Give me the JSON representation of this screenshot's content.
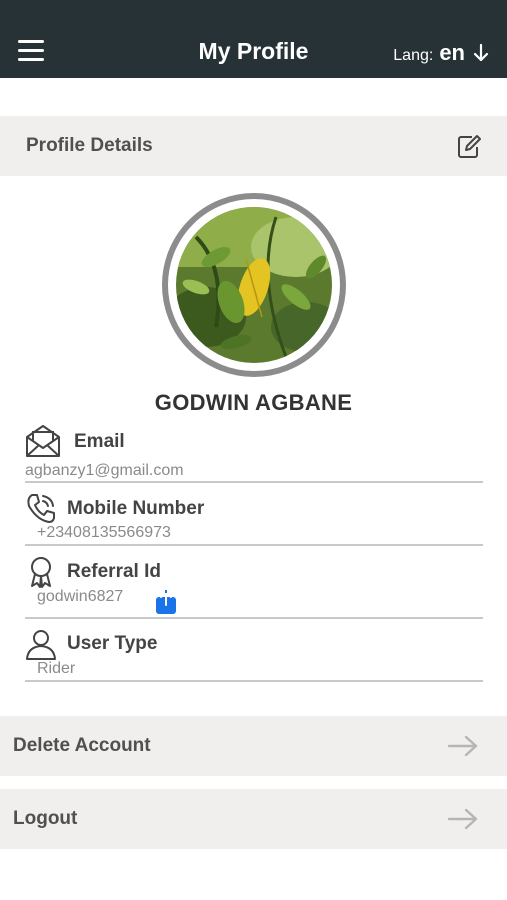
{
  "header": {
    "title": "My Profile",
    "lang_label": "Lang:",
    "lang_value": "en",
    "icons": [
      "menu-icon",
      "arrow-down-icon"
    ]
  },
  "profile_section": {
    "title": "Profile Details",
    "edit_icon": "edit-icon"
  },
  "user": {
    "name": "GODWIN AGBANE"
  },
  "fields": {
    "email": {
      "label": "Email",
      "value": "agbanzy1@gmail.com",
      "icon": "envelope-icon"
    },
    "mobile": {
      "label": "Mobile Number",
      "value": "+23408135566973",
      "icon": "phone-icon"
    },
    "referral": {
      "label": "Referral Id",
      "value": "godwin6827",
      "icon": "badge-icon",
      "share_icon": "share-icon"
    },
    "user_type": {
      "label": "User Type",
      "value": "Rider",
      "icon": "user-icon"
    }
  },
  "actions": {
    "delete_account": "Delete Account",
    "logout": "Logout"
  },
  "colors": {
    "appbar": "#263236",
    "section_bg": "#f1efee",
    "share_blue": "#1a73e8",
    "ring": "#8c8c8c"
  }
}
